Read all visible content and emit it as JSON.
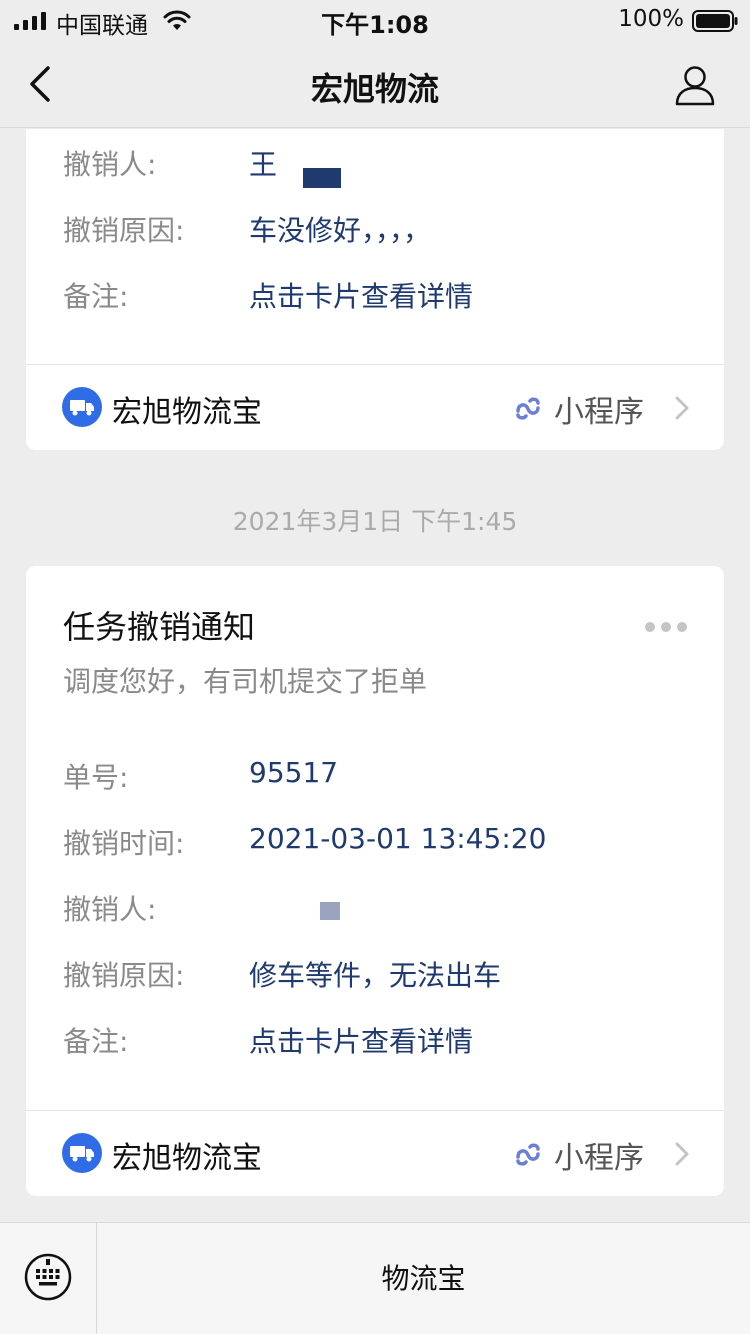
{
  "status_bar": {
    "carrier": "中国联通",
    "time": "下午1:08",
    "battery": "100%"
  },
  "nav": {
    "title": "宏旭物流"
  },
  "messages": [
    {
      "fields": [
        {
          "label": "撤销人:",
          "value": "王"
        },
        {
          "label": "撤销原因:",
          "value": "车没修好，，，，"
        },
        {
          "label": "备注:",
          "value": "点击卡片查看详情"
        }
      ],
      "footer": {
        "app_name": "宏旭物流宝",
        "tag": "小程序"
      }
    },
    {
      "timestamp": "2021年3月1日 下午1:45",
      "title": "任务撤销通知",
      "subtitle": "调度您好，有司机提交了拒单",
      "fields": [
        {
          "label": "单号:",
          "value": "95517"
        },
        {
          "label": "撤销时间:",
          "value": "2021-03-01 13:45:20"
        },
        {
          "label": "撤销人:",
          "value": ""
        },
        {
          "label": "撤销原因:",
          "value": "修车等件，无法出车"
        },
        {
          "label": "备注:",
          "value": "点击卡片查看详情"
        }
      ],
      "footer": {
        "app_name": "宏旭物流宝",
        "tag": "小程序"
      }
    }
  ],
  "bottom_bar": {
    "menu_item": "物流宝"
  },
  "colors": {
    "accent_blue": "#2f6ce5",
    "value_text": "#1f3a6e",
    "label_text": "#8a8a8a",
    "background": "#ededed"
  }
}
